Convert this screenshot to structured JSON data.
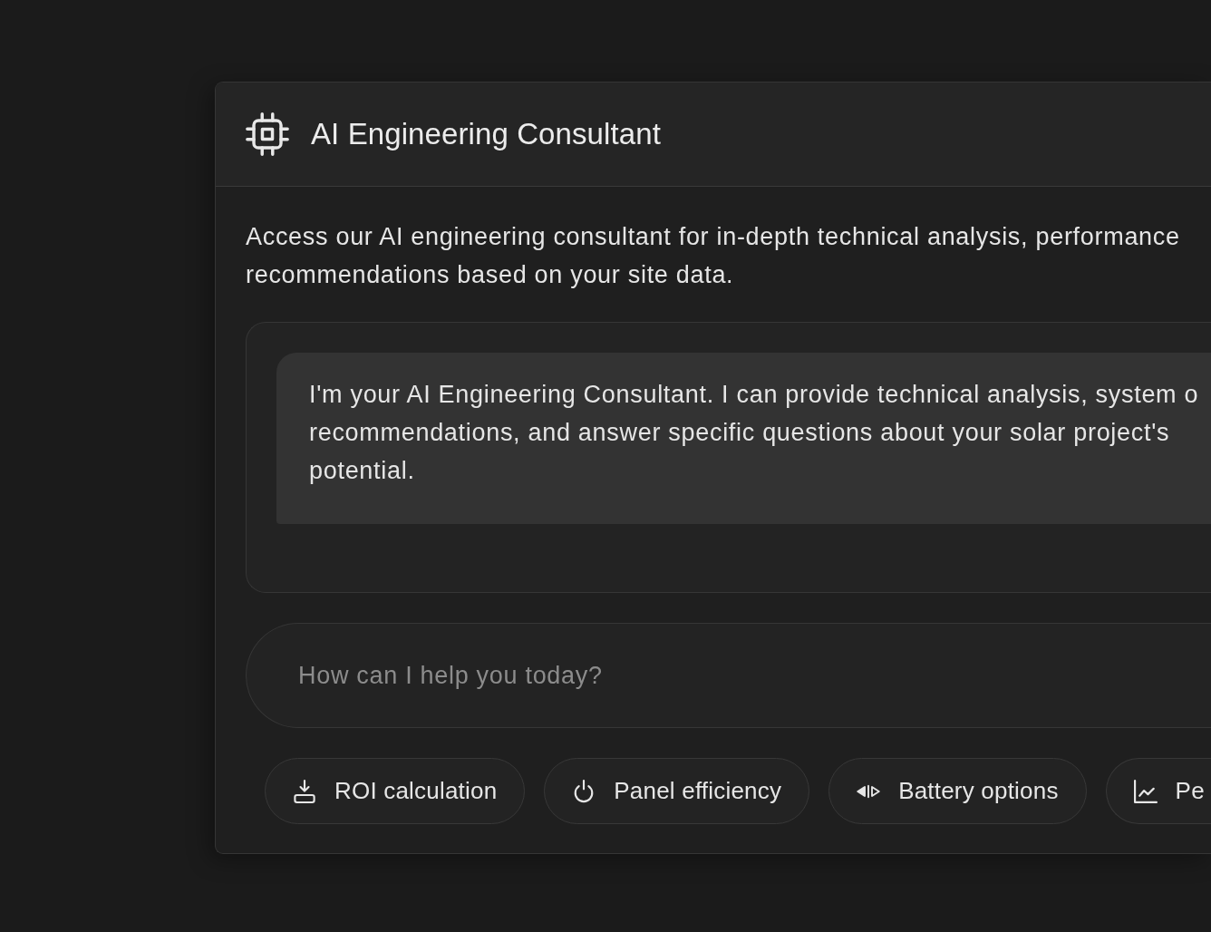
{
  "panel": {
    "title": "AI Engineering Consultant",
    "description_lines": [
      "Access our AI engineering consultant for in-depth technical analysis, performance",
      "recommendations based on your site data."
    ]
  },
  "chat": {
    "messages": [
      {
        "lines": [
          "I'm your AI Engineering Consultant. I can provide technical analysis, system o",
          "recommendations, and answer specific questions about your solar project's",
          "potential."
        ]
      }
    ]
  },
  "composer": {
    "placeholder": "How can I help you today?"
  },
  "suggestions": [
    {
      "label": "ROI calculation"
    },
    {
      "label": "Panel efficiency"
    },
    {
      "label": "Battery options"
    },
    {
      "label": "Pe"
    }
  ]
}
